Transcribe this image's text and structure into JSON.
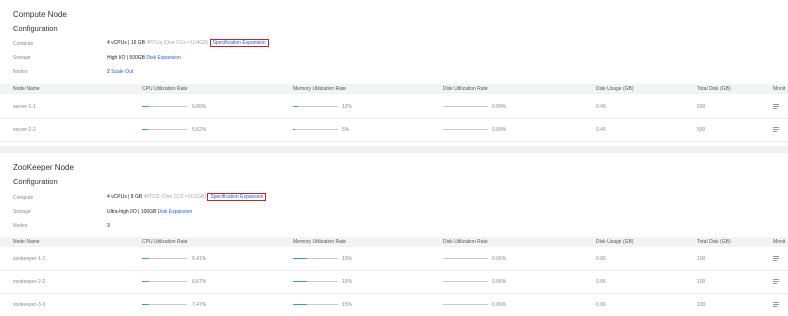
{
  "sections": [
    {
      "title": "Compute Node",
      "subtitle": "Configuration",
      "compute": {
        "label": "Compute",
        "value": "4 vCPUs | 16 GB",
        "hint": "4PCUs (One CUs =1U4GB)",
        "action": "Specification Expansion"
      },
      "storage": {
        "label": "Storage",
        "value": "High I/O | 500GB",
        "action": "Disk Expansion"
      },
      "nodes": {
        "label": "Nodes",
        "value": "2",
        "action": "Scale Out"
      },
      "headers": [
        "Node Name",
        "CPU Utilization Rate",
        "Memory Utilization Rate",
        "Disk Utilization Rate",
        "Disk Usage (GB)",
        "Total Disk (GB)",
        "Monit"
      ],
      "rows": [
        {
          "name": "server-1-1",
          "cpu": "6.89%",
          "cpu_frac": 0.15,
          "mem": "12%",
          "mem_frac": 0.12,
          "disk": "0.09%",
          "disk_frac": 0.0,
          "usage": "0.45",
          "total": "500"
        },
        {
          "name": "server-2-2",
          "cpu": "5.62%",
          "cpu_frac": 0.13,
          "mem": "5%",
          "mem_frac": 0.05,
          "disk": "0.09%",
          "disk_frac": 0.0,
          "usage": "0.45",
          "total": "500"
        }
      ]
    },
    {
      "title": "ZooKeeper Node",
      "subtitle": "Configuration",
      "compute": {
        "label": "Compute",
        "value": "4 vCPUs | 8 GB",
        "hint": "4PCU2 (One CU2 =1U2GB)",
        "action": "Specification Expansion"
      },
      "storage": {
        "label": "Storage",
        "value": "Ultra-high I/O | 100GB",
        "action": "Disk Expansion"
      },
      "nodes": {
        "label": "Nodes",
        "value": "3",
        "action": ""
      },
      "headers": [
        "Node Name",
        "CPU Utilization Rate",
        "Memory Utilization Rate",
        "Disk Utilization Rate",
        "Disk Usage (GB)",
        "Total Disk (GB)",
        "Monit"
      ],
      "rows": [
        {
          "name": "zookeeper-1-1",
          "cpu": "6.41%",
          "cpu_frac": 0.15,
          "mem": "15%",
          "mem_frac": 0.3,
          "disk": "0.06%",
          "disk_frac": 0.0,
          "usage": "0.06",
          "total": "100"
        },
        {
          "name": "zookeeper-2-2",
          "cpu": "6.87%",
          "cpu_frac": 0.15,
          "mem": "15%",
          "mem_frac": 0.3,
          "disk": "0.06%",
          "disk_frac": 0.0,
          "usage": "0.06",
          "total": "100"
        },
        {
          "name": "zookeeper-3-3",
          "cpu": "7.47%",
          "cpu_frac": 0.16,
          "mem": "15%",
          "mem_frac": 0.3,
          "disk": "0.06%",
          "disk_frac": 0.0,
          "usage": "0.06",
          "total": "100"
        }
      ]
    }
  ],
  "colors": {
    "link": "#1a5fd6",
    "highlight_border": "#d62020",
    "bar_fill": "#20b0a8"
  },
  "icons": {
    "monitor": "monitor-list-icon"
  }
}
